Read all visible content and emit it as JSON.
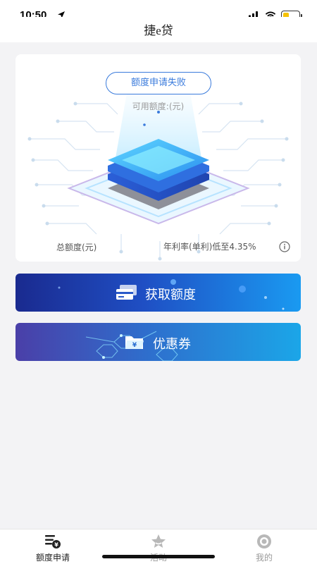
{
  "status_bar": {
    "time": "10:50",
    "battery_level": 0.4,
    "battery_color": "#f6c200",
    "icons": [
      "location-arrow-icon",
      "signal-icon",
      "wifi-icon",
      "battery-icon"
    ]
  },
  "header": {
    "title": "捷e贷"
  },
  "quota_card": {
    "status": "额度申请失败",
    "available_label": "可用额度:(元)",
    "total_label": "总额度(元)",
    "rate_label": "年利率(单利)低至4.35%",
    "icons": [
      "chip-stack-illustration",
      "info-icon"
    ]
  },
  "actions": {
    "get_quota": {
      "label": "获取额度",
      "icon": "card-icon"
    },
    "coupon": {
      "label": "优惠券",
      "icon": "yuan-folder-icon"
    }
  },
  "tabs": [
    {
      "label": "额度申请",
      "icon": "list-yen-icon",
      "active": true
    },
    {
      "label": "活动",
      "icon": "star-icon",
      "active": false
    },
    {
      "label": "我的",
      "icon": "user-icon",
      "active": false
    }
  ],
  "colors": {
    "accent": "#3a7bdc",
    "primary_gradient_start": "#1a2a8f",
    "primary_gradient_end": "#1a9af1"
  }
}
